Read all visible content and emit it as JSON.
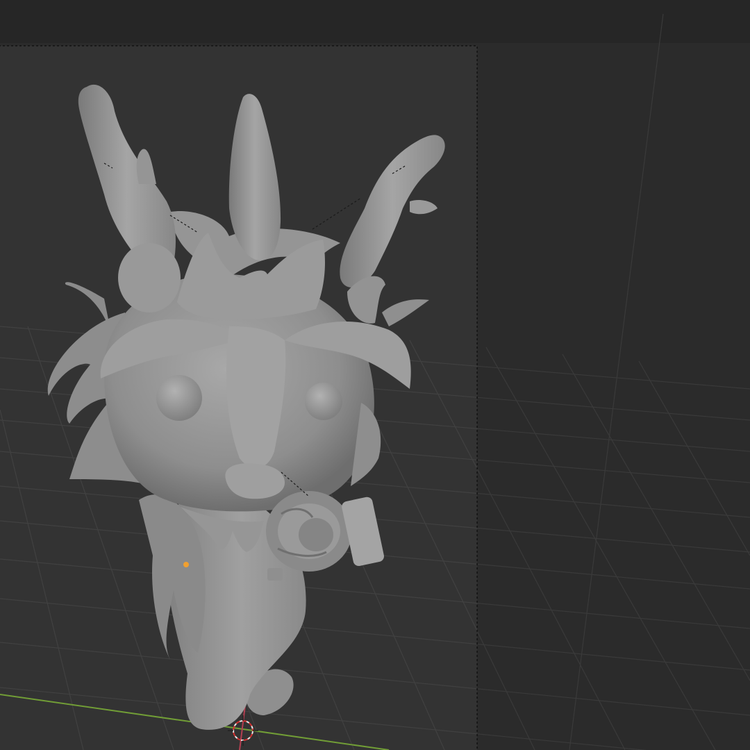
{
  "app": {
    "name": "",
    "view": "3D Viewport"
  },
  "viewport": {
    "background_color": "#2b2b2b",
    "grid_color": "#3a3a3a",
    "camera_frame_color": "#0f0f0f",
    "x_axis_color": "#b2384a",
    "y_axis_color": "#6c9a2e",
    "object_origin_color": "#f0a030",
    "object": {
      "name": "",
      "description_visible": false,
      "material_color": "#9c9c9c"
    }
  },
  "icons": {
    "3d-cursor": "3d-cursor-icon",
    "object-origin": "object-origin-icon"
  }
}
